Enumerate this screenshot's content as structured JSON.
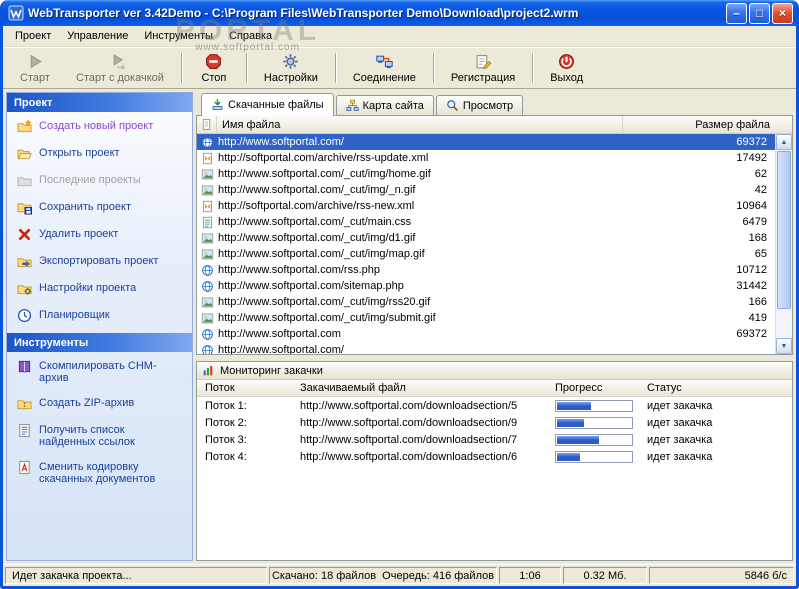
{
  "window": {
    "title": "WebTransporter ver 3.42Demo - C:\\Program Files\\WebTransporter Demo\\Download\\project2.wrm",
    "controls": {
      "minimize": "–",
      "maximize": "□",
      "close": "×"
    }
  },
  "watermark": {
    "big": "PORTAL",
    "small": "www.softportal.com"
  },
  "menu": {
    "items": [
      {
        "label": "Проект"
      },
      {
        "label": "Управление"
      },
      {
        "label": "Инструменты"
      },
      {
        "label": "Справка"
      }
    ]
  },
  "toolbar": {
    "buttons": [
      {
        "label": "Старт",
        "icon": "start-icon",
        "disabled": true,
        "sep_after": false
      },
      {
        "label": "Старт с докачкой",
        "icon": "resume-icon",
        "disabled": true,
        "sep_after": true
      },
      {
        "label": "Стоп",
        "icon": "stop-icon",
        "disabled": false,
        "sep_after": true
      },
      {
        "label": "Настройки",
        "icon": "settings-icon",
        "disabled": false,
        "sep_after": true
      },
      {
        "label": "Соединение",
        "icon": "connection-icon",
        "disabled": false,
        "sep_after": true
      },
      {
        "label": "Регистрация",
        "icon": "registration-icon",
        "disabled": false,
        "sep_after": true
      },
      {
        "label": "Выход",
        "icon": "exit-icon",
        "disabled": false,
        "sep_after": false
      }
    ]
  },
  "sidebar": {
    "sections": [
      {
        "header": "Проект",
        "items": [
          {
            "label": "Создать новый проект",
            "icon": "new-project-icon",
            "state": "active"
          },
          {
            "label": "Открыть проект",
            "icon": "open-project-icon",
            "state": "normal"
          },
          {
            "label": "Последние проекты",
            "icon": "recent-projects-icon",
            "state": "disabled"
          },
          {
            "label": "Сохранить проект",
            "icon": "save-project-icon",
            "state": "normal"
          },
          {
            "label": "Удалить проект",
            "icon": "delete-project-icon",
            "state": "normal"
          },
          {
            "label": "Экспортировать проект",
            "icon": "export-project-icon",
            "state": "normal"
          },
          {
            "label": "Настройки проекта",
            "icon": "project-settings-icon",
            "state": "normal"
          },
          {
            "label": "Планировщик",
            "icon": "scheduler-icon",
            "state": "normal"
          }
        ]
      },
      {
        "header": "Инструменты",
        "items": [
          {
            "label": "Скомпилировать CHM-архив",
            "icon": "chm-icon",
            "state": "normal"
          },
          {
            "label": "Создать ZIP-архив",
            "icon": "zip-icon",
            "state": "normal"
          },
          {
            "label": "Получить список найденных ссылок",
            "icon": "links-icon",
            "state": "normal"
          },
          {
            "label": "Сменить кодировку скачанных документов",
            "icon": "encoding-icon",
            "state": "normal"
          }
        ]
      }
    ]
  },
  "tabs": [
    {
      "label": "Скачанные файлы",
      "icon": "downloaded-files-icon",
      "active": true
    },
    {
      "label": "Карта сайта",
      "icon": "sitemap-icon",
      "active": false
    },
    {
      "label": "Просмотр",
      "icon": "preview-icon",
      "active": false
    }
  ],
  "files": {
    "columns": [
      "Имя файла",
      "Размер файла"
    ],
    "rows": [
      {
        "name": "http://www.softportal.com/",
        "size": "69372",
        "icon": "html-icon",
        "selected": true
      },
      {
        "name": "http://softportal.com/archive/rss-update.xml",
        "size": "17492",
        "icon": "xml-icon",
        "selected": false
      },
      {
        "name": "http://www.softportal.com/_cut/img/home.gif",
        "size": "62",
        "icon": "image-icon",
        "selected": false
      },
      {
        "name": "http://www.softportal.com/_cut/img/_n.gif",
        "size": "42",
        "icon": "image-icon",
        "selected": false
      },
      {
        "name": "http://softportal.com/archive/rss-new.xml",
        "size": "10964",
        "icon": "xml-icon",
        "selected": false
      },
      {
        "name": "http://www.softportal.com/_cut/main.css",
        "size": "6479",
        "icon": "css-icon",
        "selected": false
      },
      {
        "name": "http://www.softportal.com/_cut/img/d1.gif",
        "size": "168",
        "icon": "image-icon",
        "selected": false
      },
      {
        "name": "http://www.softportal.com/_cut/img/map.gif",
        "size": "65",
        "icon": "image-icon",
        "selected": false
      },
      {
        "name": "http://www.softportal.com/rss.php",
        "size": "10712",
        "icon": "html-icon",
        "selected": false
      },
      {
        "name": "http://www.softportal.com/sitemap.php",
        "size": "31442",
        "icon": "html-icon",
        "selected": false
      },
      {
        "name": "http://www.softportal.com/_cut/img/rss20.gif",
        "size": "166",
        "icon": "image-icon",
        "selected": false
      },
      {
        "name": "http://www.softportal.com/_cut/img/submit.gif",
        "size": "419",
        "icon": "image-icon",
        "selected": false
      },
      {
        "name": "http://www.softportal.com",
        "size": "69372",
        "icon": "html-icon",
        "selected": false
      },
      {
        "name": "http://www.softportal.com/",
        "size": "",
        "icon": "html-icon",
        "selected": false
      }
    ]
  },
  "monitor": {
    "title": "Мониторинг закачки",
    "columns": [
      "Поток",
      "Закачиваемый файл",
      "Прогресс",
      "Статус"
    ],
    "rows": [
      {
        "thread": "Поток 1:",
        "file": "http://www.softportal.com/downloadsection/5",
        "progress": 45,
        "status": "идет закачка"
      },
      {
        "thread": "Поток 2:",
        "file": "http://www.softportal.com/downloadsection/9",
        "progress": 35,
        "status": "идет закачка"
      },
      {
        "thread": "Поток 3:",
        "file": "http://www.softportal.com/downloadsection/7",
        "progress": 55,
        "status": "идет закачка"
      },
      {
        "thread": "Поток 4:",
        "file": "http://www.softportal.com/downloadsection/6",
        "progress": 30,
        "status": "идет закачка"
      }
    ]
  },
  "statusbar": {
    "panels": [
      "Идет закачка проекта...",
      "Скачано: 18 файлов  Очередь: 416 файлов",
      "1:06",
      "0.32 Мб.",
      "5846 б/с"
    ]
  },
  "colors": {
    "titlebar_blue": "#0855dd",
    "selection_blue": "#2f63c5",
    "progress_fill": "#2c5cc5",
    "panel_beige": "#ece9d8"
  }
}
